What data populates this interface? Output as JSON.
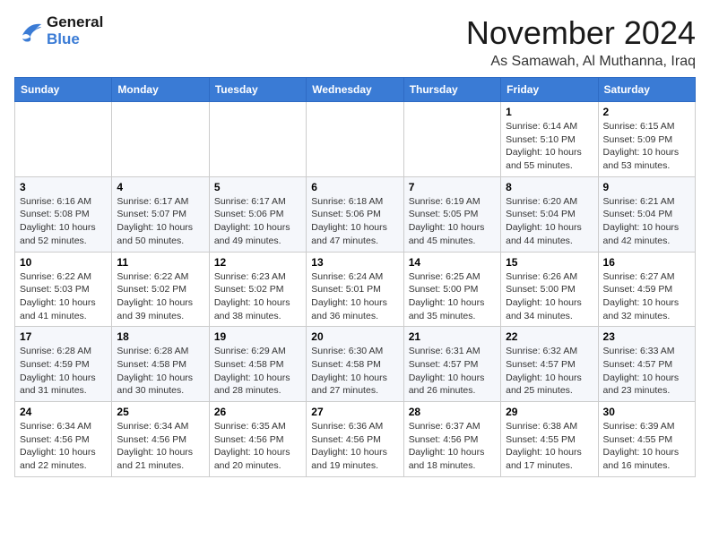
{
  "header": {
    "logo_line1": "General",
    "logo_line2": "Blue",
    "month": "November 2024",
    "location": "As Samawah, Al Muthanna, Iraq"
  },
  "weekdays": [
    "Sunday",
    "Monday",
    "Tuesday",
    "Wednesday",
    "Thursday",
    "Friday",
    "Saturday"
  ],
  "weeks": [
    [
      {
        "day": "",
        "info": ""
      },
      {
        "day": "",
        "info": ""
      },
      {
        "day": "",
        "info": ""
      },
      {
        "day": "",
        "info": ""
      },
      {
        "day": "",
        "info": ""
      },
      {
        "day": "1",
        "info": "Sunrise: 6:14 AM\nSunset: 5:10 PM\nDaylight: 10 hours and 55 minutes."
      },
      {
        "day": "2",
        "info": "Sunrise: 6:15 AM\nSunset: 5:09 PM\nDaylight: 10 hours and 53 minutes."
      }
    ],
    [
      {
        "day": "3",
        "info": "Sunrise: 6:16 AM\nSunset: 5:08 PM\nDaylight: 10 hours and 52 minutes."
      },
      {
        "day": "4",
        "info": "Sunrise: 6:17 AM\nSunset: 5:07 PM\nDaylight: 10 hours and 50 minutes."
      },
      {
        "day": "5",
        "info": "Sunrise: 6:17 AM\nSunset: 5:06 PM\nDaylight: 10 hours and 49 minutes."
      },
      {
        "day": "6",
        "info": "Sunrise: 6:18 AM\nSunset: 5:06 PM\nDaylight: 10 hours and 47 minutes."
      },
      {
        "day": "7",
        "info": "Sunrise: 6:19 AM\nSunset: 5:05 PM\nDaylight: 10 hours and 45 minutes."
      },
      {
        "day": "8",
        "info": "Sunrise: 6:20 AM\nSunset: 5:04 PM\nDaylight: 10 hours and 44 minutes."
      },
      {
        "day": "9",
        "info": "Sunrise: 6:21 AM\nSunset: 5:04 PM\nDaylight: 10 hours and 42 minutes."
      }
    ],
    [
      {
        "day": "10",
        "info": "Sunrise: 6:22 AM\nSunset: 5:03 PM\nDaylight: 10 hours and 41 minutes."
      },
      {
        "day": "11",
        "info": "Sunrise: 6:22 AM\nSunset: 5:02 PM\nDaylight: 10 hours and 39 minutes."
      },
      {
        "day": "12",
        "info": "Sunrise: 6:23 AM\nSunset: 5:02 PM\nDaylight: 10 hours and 38 minutes."
      },
      {
        "day": "13",
        "info": "Sunrise: 6:24 AM\nSunset: 5:01 PM\nDaylight: 10 hours and 36 minutes."
      },
      {
        "day": "14",
        "info": "Sunrise: 6:25 AM\nSunset: 5:00 PM\nDaylight: 10 hours and 35 minutes."
      },
      {
        "day": "15",
        "info": "Sunrise: 6:26 AM\nSunset: 5:00 PM\nDaylight: 10 hours and 34 minutes."
      },
      {
        "day": "16",
        "info": "Sunrise: 6:27 AM\nSunset: 4:59 PM\nDaylight: 10 hours and 32 minutes."
      }
    ],
    [
      {
        "day": "17",
        "info": "Sunrise: 6:28 AM\nSunset: 4:59 PM\nDaylight: 10 hours and 31 minutes."
      },
      {
        "day": "18",
        "info": "Sunrise: 6:28 AM\nSunset: 4:58 PM\nDaylight: 10 hours and 30 minutes."
      },
      {
        "day": "19",
        "info": "Sunrise: 6:29 AM\nSunset: 4:58 PM\nDaylight: 10 hours and 28 minutes."
      },
      {
        "day": "20",
        "info": "Sunrise: 6:30 AM\nSunset: 4:58 PM\nDaylight: 10 hours and 27 minutes."
      },
      {
        "day": "21",
        "info": "Sunrise: 6:31 AM\nSunset: 4:57 PM\nDaylight: 10 hours and 26 minutes."
      },
      {
        "day": "22",
        "info": "Sunrise: 6:32 AM\nSunset: 4:57 PM\nDaylight: 10 hours and 25 minutes."
      },
      {
        "day": "23",
        "info": "Sunrise: 6:33 AM\nSunset: 4:57 PM\nDaylight: 10 hours and 23 minutes."
      }
    ],
    [
      {
        "day": "24",
        "info": "Sunrise: 6:34 AM\nSunset: 4:56 PM\nDaylight: 10 hours and 22 minutes."
      },
      {
        "day": "25",
        "info": "Sunrise: 6:34 AM\nSunset: 4:56 PM\nDaylight: 10 hours and 21 minutes."
      },
      {
        "day": "26",
        "info": "Sunrise: 6:35 AM\nSunset: 4:56 PM\nDaylight: 10 hours and 20 minutes."
      },
      {
        "day": "27",
        "info": "Sunrise: 6:36 AM\nSunset: 4:56 PM\nDaylight: 10 hours and 19 minutes."
      },
      {
        "day": "28",
        "info": "Sunrise: 6:37 AM\nSunset: 4:56 PM\nDaylight: 10 hours and 18 minutes."
      },
      {
        "day": "29",
        "info": "Sunrise: 6:38 AM\nSunset: 4:55 PM\nDaylight: 10 hours and 17 minutes."
      },
      {
        "day": "30",
        "info": "Sunrise: 6:39 AM\nSunset: 4:55 PM\nDaylight: 10 hours and 16 minutes."
      }
    ]
  ]
}
